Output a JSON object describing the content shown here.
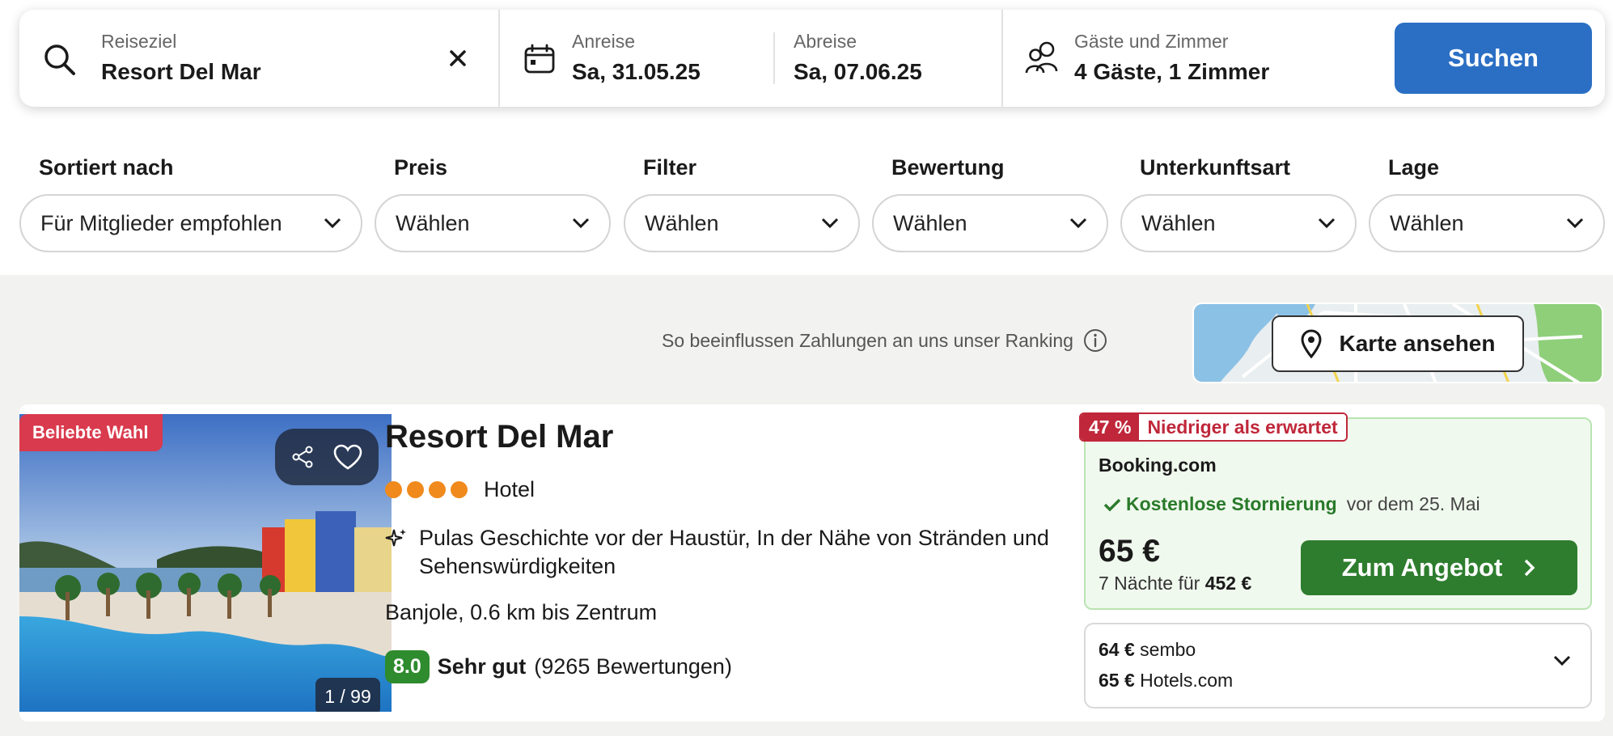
{
  "search": {
    "destination_label": "Reiseziel",
    "destination_value": "Resort Del Mar",
    "checkin_label": "Anreise",
    "checkin_value": "Sa, 31.05.25",
    "checkout_label": "Abreise",
    "checkout_value": "Sa, 07.06.25",
    "guests_label": "Gäste und Zimmer",
    "guests_value": "4 Gäste, 1 Zimmer",
    "search_button": "Suchen"
  },
  "filters": [
    {
      "title": "Sortiert nach",
      "value": "Für Mitglieder empfohlen"
    },
    {
      "title": "Preis",
      "value": "Wählen"
    },
    {
      "title": "Filter",
      "value": "Wählen"
    },
    {
      "title": "Bewertung",
      "value": "Wählen"
    },
    {
      "title": "Unterkunftsart",
      "value": "Wählen"
    },
    {
      "title": "Lage",
      "value": "Wählen"
    }
  ],
  "ranking_note": "So beeinflussen Zahlungen an uns unser Ranking",
  "map_button": "Karte ansehen",
  "result": {
    "badge": "Beliebte Wahl",
    "photo_counter": "1 / 99",
    "name": "Resort Del Mar",
    "stars": 4,
    "type": "Hotel",
    "highlight": "Pulas Geschichte vor der Haustür, In der Nähe von Stränden und Sehenswürdigkeiten",
    "location": "Banjole, 0.6 km bis Zentrum",
    "rating_score": "8.0",
    "rating_word": "Sehr gut",
    "rating_count": "(9265 Bewertungen)",
    "deal_percent": "47 %",
    "deal_text": "Niedriger als erwartet",
    "provider": "Booking.com",
    "free_cancel": "Kostenlose Stornierung",
    "free_cancel_until": "vor dem 25. Mai",
    "price": "65 €",
    "nights_text": "7 Nächte für",
    "total_price": "452 €",
    "deal_button": "Zum Angebot",
    "other_offers": [
      {
        "price": "64 €",
        "provider": "sembo"
      },
      {
        "price": "65 €",
        "provider": "Hotels.com"
      }
    ]
  },
  "colors": {
    "search_button": "#2b6fc4",
    "deal_button": "#2e7d2e",
    "badge_popular": "#d93a4d",
    "deal_badge": "#c0273a",
    "rating_badge": "#2e8b2e",
    "star": "#f08a1c"
  }
}
